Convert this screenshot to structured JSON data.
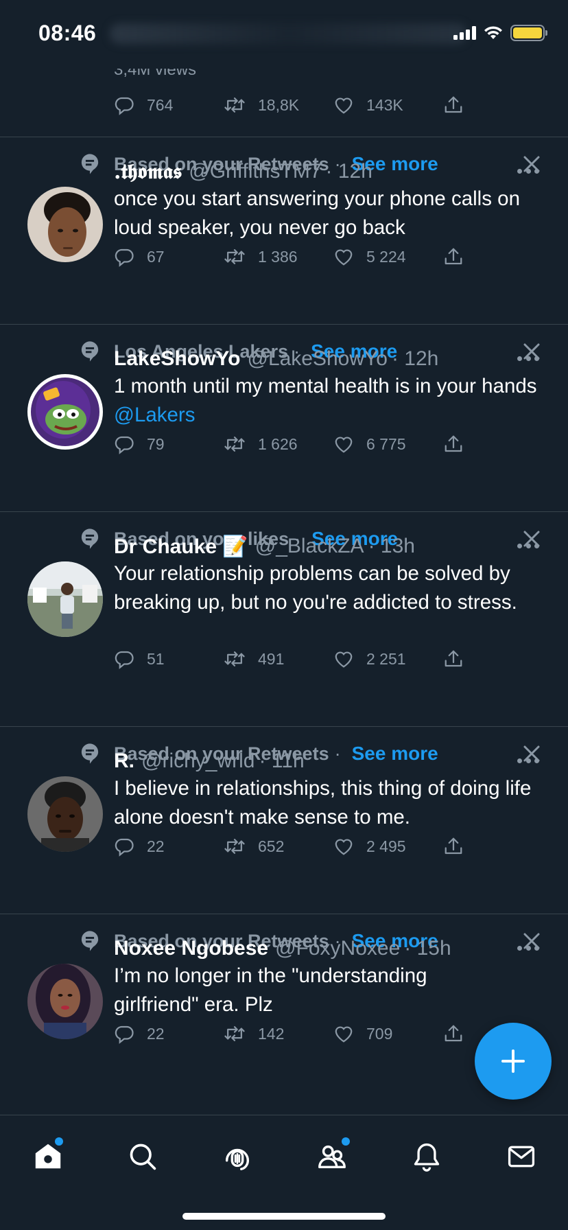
{
  "status_bar": {
    "time": "08:46"
  },
  "top_tweet": {
    "views": "3,4M views",
    "replies": "764",
    "retweets": "18,8K",
    "likes": "143K"
  },
  "tweets": [
    {
      "context": "Based on your Retweets",
      "see_more": "See more",
      "name": ".𝖙𝖍𝖔𝖒𝖆𝖘",
      "handle": "@GriffithsTM7",
      "time": "· 12h",
      "text": "once you start answering your phone calls on loud speaker, you never go back",
      "mention": "",
      "replies": "67",
      "retweets": "1 386",
      "likes": "5 224"
    },
    {
      "context": "Los Angeles Lakers",
      "see_more": "See more",
      "name": "LakeShowYo",
      "handle": "@LakeShowYo",
      "time": "· 12h",
      "text": "1 month until my mental health is in your hands ",
      "mention": "@Lakers",
      "replies": "79",
      "retweets": "1 626",
      "likes": "6 775"
    },
    {
      "context": "Based on your likes",
      "see_more": "See more",
      "name": "Dr Chauke 📝",
      "handle": "@_BlackZA",
      "time": "· 13h",
      "text": "Your relationship problems can be solved by breaking up, but no you're addicted to stress.",
      "mention": "",
      "replies": "51",
      "retweets": "491",
      "likes": "2 251"
    },
    {
      "context": "Based on your Retweets",
      "see_more": "See more",
      "name": "R.",
      "handle": "@richy_wrld",
      "time": "· 11h",
      "text": "I believe in relationships, this thing of doing life alone doesn't make sense to me.",
      "mention": "",
      "replies": "22",
      "retweets": "652",
      "likes": "2 495"
    },
    {
      "context": "Based on your Retweets",
      "see_more": "See more",
      "name": "Noxee Ngobese",
      "handle": "@FoxyNoxee",
      "time": "· 15h",
      "text": "I’m no longer in the \"understanding girlfriend\" era. Plz",
      "mention": "",
      "replies": "22",
      "retweets": "142",
      "likes": "709"
    }
  ],
  "colors": {
    "background": "#15202b",
    "accent": "#1d9bf0",
    "muted": "#8b98a5",
    "divider": "#38444d",
    "battery": "#f5d63d"
  },
  "tabbar": {
    "items": [
      "home-icon",
      "search-icon",
      "spaces-icon",
      "communities-icon",
      "notifications-icon",
      "messages-icon"
    ]
  }
}
